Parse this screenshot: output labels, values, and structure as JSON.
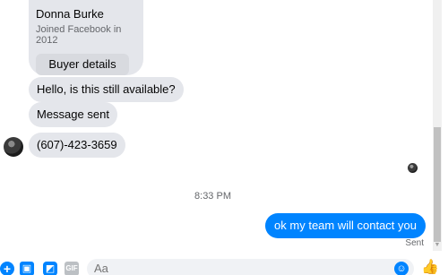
{
  "card": {
    "name": "Donna Burke",
    "joined": "Joined Facebook in 2012",
    "button_label": "Buyer details"
  },
  "messages": {
    "incoming_1": "Hello, is this still available?",
    "incoming_2": "Message sent",
    "incoming_3": "(607)-423-3659",
    "timestamp": "8:33 PM",
    "outgoing_1": "ok my team will contact you",
    "status": "Sent"
  },
  "composer": {
    "placeholder": "Aa",
    "gif_label": "GIF"
  },
  "icons": {
    "plus": "plus-icon",
    "photo": "photo-icon",
    "sticker": "sticker-icon",
    "gif": "gif-icon",
    "emoji": "emoji-icon",
    "like": "thumbs-up-icon"
  },
  "colors": {
    "accent": "#0084ff",
    "incoming_bubble": "#e4e6eb",
    "secondary_text": "#65676b"
  }
}
